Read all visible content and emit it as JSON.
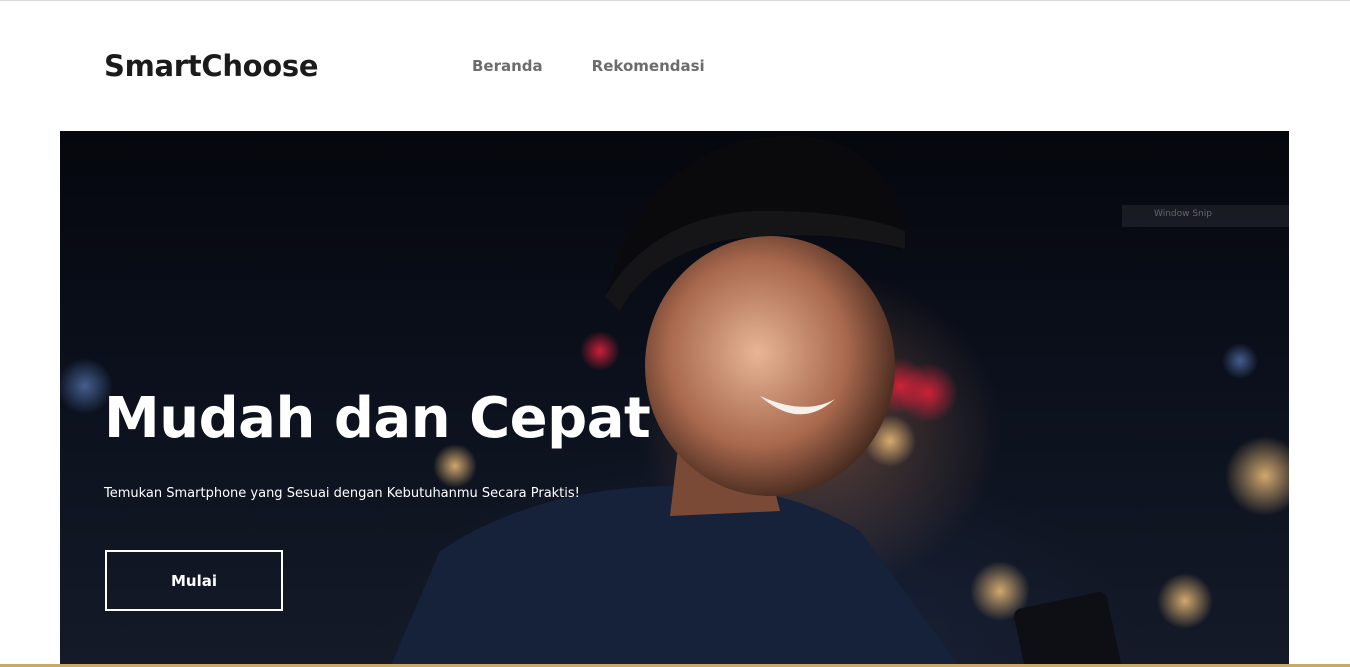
{
  "brand": {
    "logo_text": "SmartChoose"
  },
  "nav": {
    "items": [
      {
        "label": "Beranda"
      },
      {
        "label": "Rekomendasi"
      }
    ]
  },
  "hero": {
    "title": "Mudah dan Cepat",
    "subtitle": "Temukan Smartphone yang Sesuai dengan Kebutuhanmu Secara Praktis!",
    "cta_label": "Mulai",
    "watermark_text": "Window Snip"
  },
  "colors": {
    "accent_bar": "#c9a96b",
    "logo_text": "#1b1b1b",
    "nav_text": "#6c6c6c",
    "hero_text": "#ffffff"
  }
}
